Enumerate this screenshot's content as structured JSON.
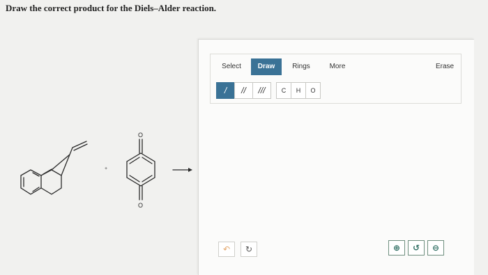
{
  "question": "Draw the correct product for the Diels–Alder reaction.",
  "reaction": {
    "oxygen_label": "O",
    "plus_sign": "+",
    "diene_name": "1-vinyl-3,4-dihydronaphthalene",
    "dienophile_name": "1,4-benzoquinone"
  },
  "editor": {
    "tabs": [
      {
        "label": "Select",
        "active": false
      },
      {
        "label": "Draw",
        "active": true
      },
      {
        "label": "Rings",
        "active": false
      },
      {
        "label": "More",
        "active": false
      },
      {
        "label": "Erase",
        "active": false
      }
    ],
    "bond_buttons": [
      {
        "label": "/",
        "name": "single-bond",
        "active": true
      },
      {
        "label": "//",
        "name": "double-bond",
        "active": false
      },
      {
        "label": "///",
        "name": "triple-bond",
        "active": false
      }
    ],
    "atom_buttons": [
      "C",
      "H",
      "O"
    ],
    "undo_icon": "undo-icon",
    "redo_icon": "redo-icon",
    "zoom_in_icon": "zoom-in-icon",
    "reset_icon": "reset-view-icon",
    "zoom_out_icon": "zoom-out-icon"
  },
  "colors": {
    "accent": "#3a7296",
    "zoom_accent": "#2e6e62",
    "undo": "#e3a66a"
  }
}
